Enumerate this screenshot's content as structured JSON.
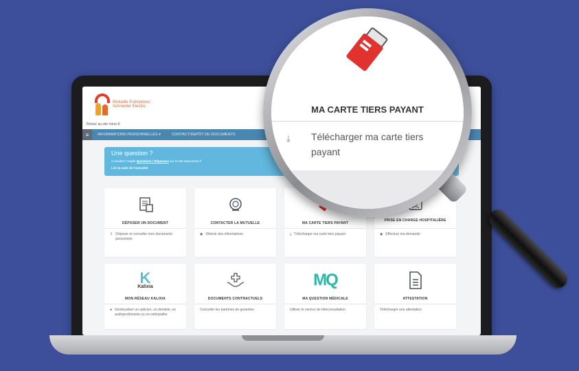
{
  "site": {
    "logo_text": "Mutuelle Entreprises Schneider Electric",
    "back_link": "Retour au site mesc.fr"
  },
  "nav": {
    "items": [
      "INFORMATIONS PERSONNELLES ▾",
      "CONTACT/DEPÔT DE DOCUMENTS"
    ]
  },
  "question": {
    "title": "Une question ?",
    "sub_prefix": "Consultez l'onglet",
    "sub_link": "Questions / Réponses",
    "sub_suffix": "sur le site www.mesc.fr",
    "link": "Lire la suite de l'actualité"
  },
  "cards": [
    {
      "title": "DÉPOSER UN DOCUMENT",
      "icon": "document-upload-icon",
      "desc": "Déposer et consulter mes documents personnels"
    },
    {
      "title": "CONTACTER LA MUTUELLE",
      "icon": "headset-icon",
      "desc": "Obtenir des informations"
    },
    {
      "title": "MA CARTE TIERS PAYANT",
      "icon": "card-icon",
      "desc": "Télécharger ma carte tiers payant"
    },
    {
      "title": "PRISE EN CHARGE HOSPITALIÈRE",
      "icon": "hospital-badge-icon",
      "desc": "Effectuer ma demande"
    },
    {
      "title": "MON RÉSEAU KALIXIA",
      "icon": "kalixia-logo",
      "logo_word": "Kalixia",
      "desc": "Géolocaliser un opticien, un dentiste, un audioprothésiste ou un ostéopathe"
    },
    {
      "title": "DOCUMENTS CONTRACTUELS",
      "icon": "hands-cross-icon",
      "desc": "Consulter les barèmes de garanties"
    },
    {
      "title": "MA QUESTION MÉDICALE",
      "icon": "mq-logo",
      "logo_word": "MQ",
      "desc": "Utiliser le service de téléconsultation"
    },
    {
      "title": "ATTESTATION",
      "icon": "file-icon",
      "desc": "Télécharger une attestation"
    }
  ],
  "lens": {
    "title": "MA CARTE TIERS PAYANT",
    "desc": "Télécharger ma carte tiers payant"
  }
}
